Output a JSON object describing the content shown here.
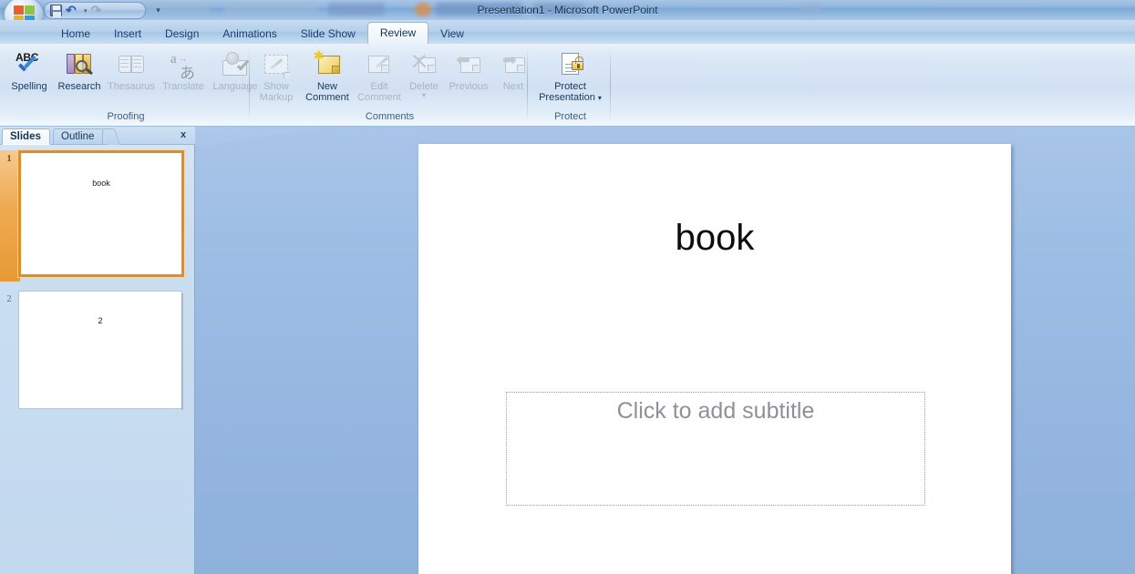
{
  "window": {
    "title": "Presentation1 - Microsoft PowerPoint",
    "quick_access": {
      "save_label": "Save",
      "undo_label": "Undo",
      "undo_arrow": "▾",
      "redo_label": "Redo",
      "customize_label": "☰",
      "save_icon": "floppy-disk-icon",
      "undo_icon": "undo-arrow-icon",
      "redo_icon": "redo-arrow-icon"
    },
    "office_button": "office-orb-icon"
  },
  "ribbon": {
    "tabs": [
      {
        "label": "Home",
        "active": false
      },
      {
        "label": "Insert",
        "active": false
      },
      {
        "label": "Design",
        "active": false
      },
      {
        "label": "Animations",
        "active": false
      },
      {
        "label": "Slide Show",
        "active": false
      },
      {
        "label": "Review",
        "active": true
      },
      {
        "label": "View",
        "active": false
      }
    ],
    "groups": [
      {
        "name": "Proofing",
        "label": "Proofing",
        "items": [
          {
            "label": "Spelling",
            "icon": "spelling-abc-check-icon",
            "enabled": true
          },
          {
            "label": "Research",
            "icon": "research-books-magnifier-icon",
            "enabled": true
          },
          {
            "label": "Thesaurus",
            "icon": "thesaurus-open-book-icon",
            "enabled": false
          },
          {
            "label": "Translate",
            "icon": "translate-a-icon",
            "enabled": false
          },
          {
            "label": "Language",
            "icon": "language-globe-check-icon",
            "enabled": false
          }
        ]
      },
      {
        "name": "Comments",
        "label": "Comments",
        "items": [
          {
            "label": "Show",
            "label2": "Markup",
            "icon": "show-markup-icon",
            "enabled": false
          },
          {
            "label": "New",
            "label2": "Comment",
            "icon": "new-comment-note-icon",
            "enabled": true
          },
          {
            "label": "Edit",
            "label2": "Comment",
            "icon": "edit-comment-icon",
            "enabled": false
          },
          {
            "label": "Delete",
            "label2": "",
            "icon": "delete-comment-icon",
            "enabled": false,
            "has_dropdown": true,
            "dropdown_glyph": "▾"
          },
          {
            "label": "Previous",
            "label2": "",
            "icon": "previous-comment-arrow-icon",
            "enabled": false
          },
          {
            "label": "Next",
            "label2": "",
            "icon": "next-comment-arrow-icon",
            "enabled": false
          }
        ]
      },
      {
        "name": "Protect",
        "label": "Protect",
        "items": [
          {
            "label": "Protect",
            "label2": "Presentation",
            "icon": "protect-document-lock-icon",
            "enabled": true,
            "has_dropdown": true,
            "dropdown_glyph": "▾"
          }
        ]
      }
    ]
  },
  "slide_pane": {
    "tabs": [
      {
        "label": "Slides",
        "active": true
      },
      {
        "label": "Outline",
        "active": false
      }
    ],
    "close_label": "x",
    "close_icon": "close-pane-icon",
    "thumbnails": [
      {
        "number": "1",
        "text": "book",
        "selected": true
      },
      {
        "number": "2",
        "text": "2",
        "selected": false
      }
    ]
  },
  "slide": {
    "title": "book",
    "subtitle_placeholder": "Click to add subtitle"
  },
  "colors": {
    "accent_selection": "#e08c28",
    "ribbon_text": "#16395e",
    "workspace_blue": "#93b5df",
    "disabled_text": "#a8b4c2",
    "placeholder_gray": "#8e9199"
  }
}
